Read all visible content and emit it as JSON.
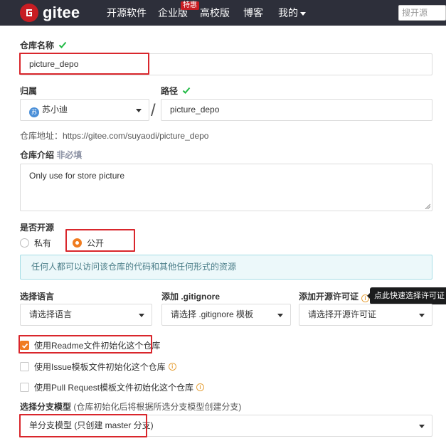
{
  "nav": {
    "logo_text": "gitee",
    "links": [
      "开源软件",
      "企业版",
      "高校版",
      "博客",
      "我的"
    ],
    "badge": "特惠",
    "search_placeholder": "搜开源"
  },
  "form": {
    "repo_name": {
      "label": "仓库名称",
      "value": "picture_depo"
    },
    "owner": {
      "label": "归属",
      "avatar_text": "苏",
      "value": "苏小迪"
    },
    "slash": "/",
    "path": {
      "label": "路径",
      "value": "picture_depo"
    },
    "repo_url": "仓库地址：https://gitee.com/suyaodi/picture_depo",
    "intro": {
      "label": "仓库介绍",
      "optional": "非必填",
      "value": "Only use for store picture"
    },
    "open_source": {
      "label": "是否开源",
      "private_label": "私有",
      "public_label": "公开",
      "selected": "public",
      "info": "任何人都可以访问该仓库的代码和其他任何形式的资源"
    },
    "language": {
      "label": "选择语言",
      "placeholder": "请选择语言"
    },
    "gitignore": {
      "label": "添加 .gitignore",
      "placeholder": "请选择 .gitignore 模板"
    },
    "license": {
      "label": "添加开源许可证",
      "placeholder": "请选择开源许可证",
      "tooltip": "点此快速选择许可证"
    },
    "init_readme": {
      "label": "使用Readme文件初始化这个仓库",
      "checked": true
    },
    "init_issue": {
      "label": "使用Issue模板文件初始化这个仓库",
      "checked": false
    },
    "init_pr": {
      "label": "使用Pull Request模板文件初始化这个仓库",
      "checked": false
    },
    "branch_model": {
      "label": "选择分支模型",
      "hint": "(仓库初始化后将根据所选分支模型创建分支)",
      "value": "单分支模型 (只创建 master 分支)"
    }
  },
  "colors": {
    "nav_bg": "#2d2f3a",
    "brand_red": "#c71d23",
    "accent_orange": "#f07c20",
    "check_green": "#21ba45",
    "annotation_red": "#d9262c"
  }
}
